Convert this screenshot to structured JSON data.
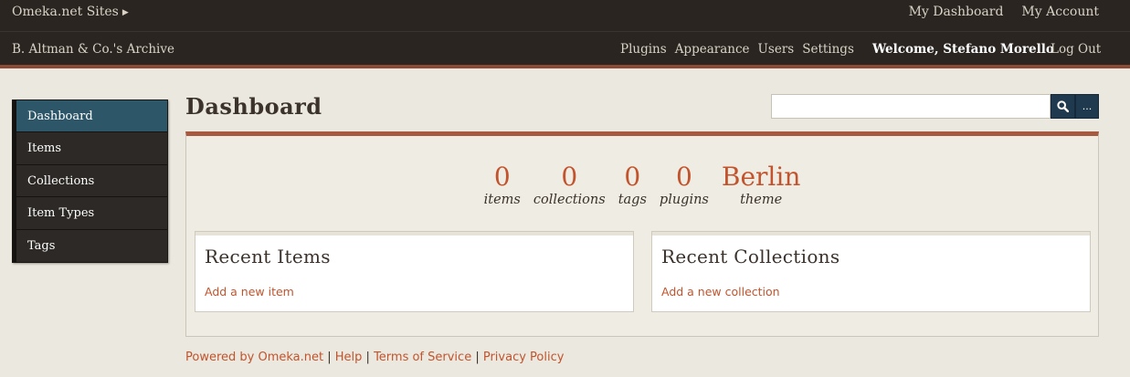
{
  "topbar": {
    "sites_label": "Omeka.net Sites",
    "my_dashboard": "My Dashboard",
    "my_account": "My Account"
  },
  "subbar": {
    "site_title": "B. Altman & Co.'s Archive",
    "nav": [
      "Plugins",
      "Appearance",
      "Users",
      "Settings"
    ],
    "welcome": "Welcome, Stefano Morello",
    "logout": "Log Out"
  },
  "sidebar": {
    "items": [
      "Dashboard",
      "Items",
      "Collections",
      "Item Types",
      "Tags"
    ],
    "active": "Dashboard"
  },
  "main": {
    "title": "Dashboard",
    "search": {
      "value": "",
      "advanced_label": "..."
    },
    "stats": [
      {
        "value": "0",
        "label": "items"
      },
      {
        "value": "0",
        "label": "collections"
      },
      {
        "value": "0",
        "label": "tags"
      },
      {
        "value": "0",
        "label": "plugins"
      },
      {
        "value": "Berlin",
        "label": "theme"
      }
    ],
    "recent_items": {
      "heading": "Recent Items",
      "link": "Add a new item"
    },
    "recent_collections": {
      "heading": "Recent Collections",
      "link": "Add a new collection"
    }
  },
  "footer": {
    "links": [
      "Powered by Omeka.net",
      "Help",
      "Terms of Service",
      "Privacy Policy"
    ],
    "separator": " | "
  },
  "colors": {
    "accent": "#c2542d",
    "header_bg": "#2a2520",
    "active_nav": "#2d5668",
    "search_button": "#1f3a4e"
  }
}
